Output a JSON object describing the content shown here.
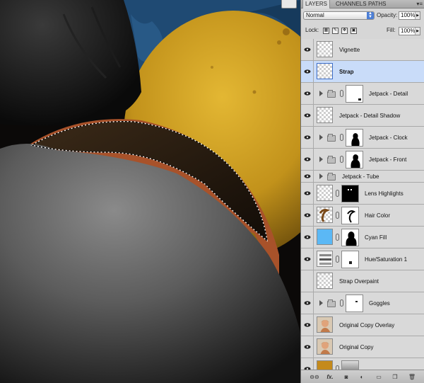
{
  "panel": {
    "tabs": [
      "LAYERS",
      "CHANNELS",
      "PATHS"
    ],
    "menu_glyph": "▾≡",
    "blend_mode": "Normal",
    "opacity_label": "Opacity:",
    "opacity_value": "100%",
    "lock_label": "Lock:",
    "fill_label": "Fill:",
    "fill_value": "100%",
    "lock_icons": [
      "lock-transparency-icon",
      "lock-image-icon",
      "lock-position-icon",
      "lock-all-icon"
    ],
    "accent_color": "#4d7fd6",
    "selected_color": "#c9dcf9"
  },
  "layers": [
    {
      "name": "Vignette",
      "type": "pixel",
      "selected": false
    },
    {
      "name": "Strap",
      "type": "pixel",
      "selected": true
    },
    {
      "name": "Jetpack - Detail",
      "type": "group-mask"
    },
    {
      "name": "Jetpack - Detail Shadow",
      "type": "pixel"
    },
    {
      "name": "Jetpack - Clock",
      "type": "group-mask"
    },
    {
      "name": "Jetpack - Front",
      "type": "group-mask"
    },
    {
      "name": "Jetpack - Tube",
      "type": "group"
    },
    {
      "name": "Lens Highlights",
      "type": "pixel-mask"
    },
    {
      "name": "Hair Color",
      "type": "pixel-mask"
    },
    {
      "name": "Cyan Fill",
      "type": "fill-mask",
      "fill_color": "#5bb8f5"
    },
    {
      "name": "Hue/Saturation 1",
      "type": "adjustment-mask"
    },
    {
      "name": "Strap Overpaint",
      "type": "pixel"
    },
    {
      "name": "Goggles",
      "type": "group-mask"
    },
    {
      "name": "Original Copy Overlay",
      "type": "photo"
    },
    {
      "name": "Original Copy",
      "type": "photo"
    },
    {
      "name": "",
      "type": "partial"
    }
  ],
  "bottom_bar": {
    "buttons": [
      "link-layers-icon",
      "fx",
      "add-mask-icon",
      "adjustment-layer-icon",
      "new-group-icon",
      "new-layer-icon",
      "trash-icon"
    ],
    "fx_label": "fx."
  },
  "canvas": {
    "colors": {
      "sky": "#1f4a73",
      "ball": "#c99a1e",
      "skin": "#6e6e6e",
      "shadow": "#0b0908"
    }
  }
}
